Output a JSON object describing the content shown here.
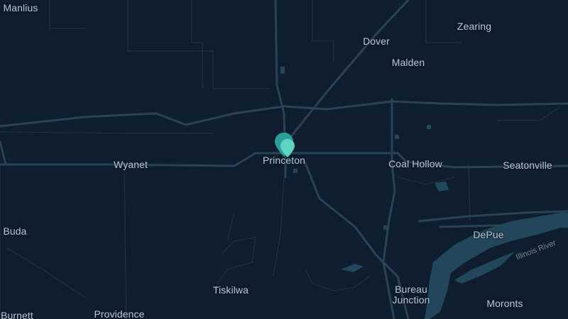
{
  "places": [
    {
      "id": "manlius",
      "label": "Manlius"
    },
    {
      "id": "dover",
      "label": "Dover"
    },
    {
      "id": "zearing",
      "label": "Zearing"
    },
    {
      "id": "malden",
      "label": "Malden"
    },
    {
      "id": "wyanet",
      "label": "Wyanet"
    },
    {
      "id": "princeton",
      "label": "Princeton"
    },
    {
      "id": "coal-hollow",
      "label": "Coal Hollow"
    },
    {
      "id": "seatonville",
      "label": "Seatonville"
    },
    {
      "id": "buda",
      "label": "Buda"
    },
    {
      "id": "depue",
      "label": "DePue"
    },
    {
      "id": "tiskilwa",
      "label": "Tiskilwa"
    },
    {
      "id": "bureau-junction",
      "label": "Bureau\nJunction"
    },
    {
      "id": "moronts",
      "label": "Moronts"
    },
    {
      "id": "burnett",
      "label": "Burnett"
    },
    {
      "id": "providence",
      "label": "Providence"
    }
  ],
  "river": {
    "label": "Illinois River"
  },
  "colors": {
    "background": "#0e1e2e",
    "major_road": "#2b4254",
    "minor_road": "#1b3142",
    "water": "#23475a",
    "label": "#b9c6d0",
    "marker_back": "#2a9f99",
    "marker_front": "#5fd3c2"
  },
  "marker": {
    "icon": "map-pin-icon",
    "count": 2
  }
}
